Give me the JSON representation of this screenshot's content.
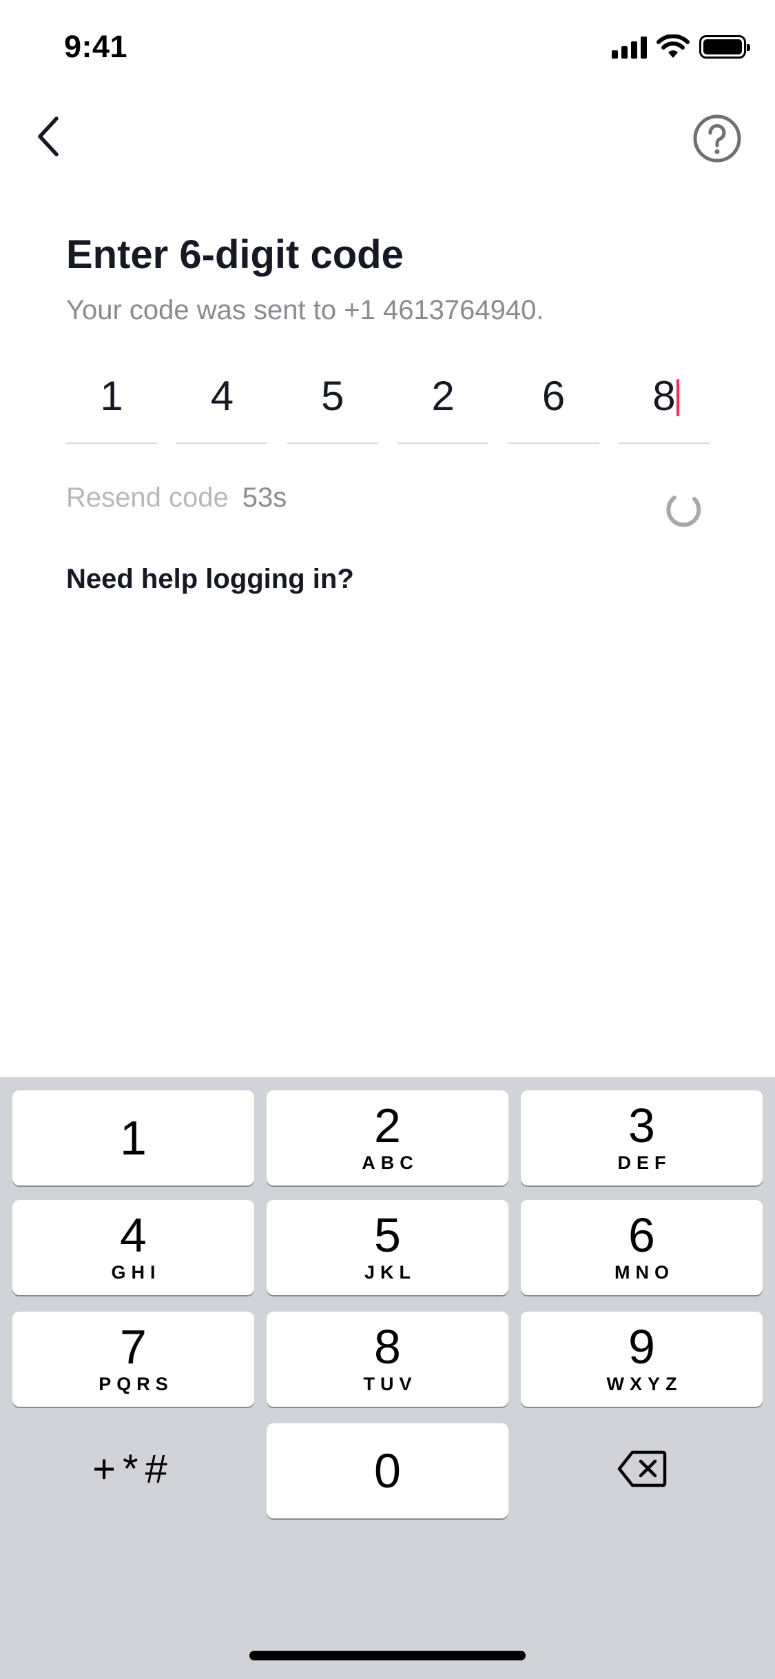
{
  "status_bar": {
    "time": "9:41",
    "icons": [
      "signal-icon",
      "wifi-icon",
      "battery-icon"
    ]
  },
  "nav": {
    "back_icon": "chevron-left-icon",
    "help_icon": "question-circle-icon"
  },
  "content": {
    "title": "Enter 6-digit code",
    "subtitle": "Your code was sent to +1 4613764940.",
    "code_digits": [
      "1",
      "4",
      "5",
      "2",
      "6",
      "8"
    ],
    "resend_label": "Resend code",
    "resend_timer": "53s",
    "help_link": "Need help logging in?"
  },
  "keypad": {
    "keys": [
      {
        "number": "1",
        "letters": ""
      },
      {
        "number": "2",
        "letters": "ABC"
      },
      {
        "number": "3",
        "letters": "DEF"
      },
      {
        "number": "4",
        "letters": "GHI"
      },
      {
        "number": "5",
        "letters": "JKL"
      },
      {
        "number": "6",
        "letters": "MNO"
      },
      {
        "number": "7",
        "letters": "PQRS"
      },
      {
        "number": "8",
        "letters": "TUV"
      },
      {
        "number": "9",
        "letters": "WXYZ"
      },
      {
        "number": "0",
        "letters": ""
      }
    ],
    "symbols_label": "+*#",
    "delete_icon": "backspace-icon"
  },
  "colors": {
    "accent_caret": "#fe2c55",
    "keypad_background": "#d1d3d9",
    "text_primary": "#161823",
    "text_secondary": "#8a8b91",
    "text_disabled": "#b7b8bc"
  }
}
